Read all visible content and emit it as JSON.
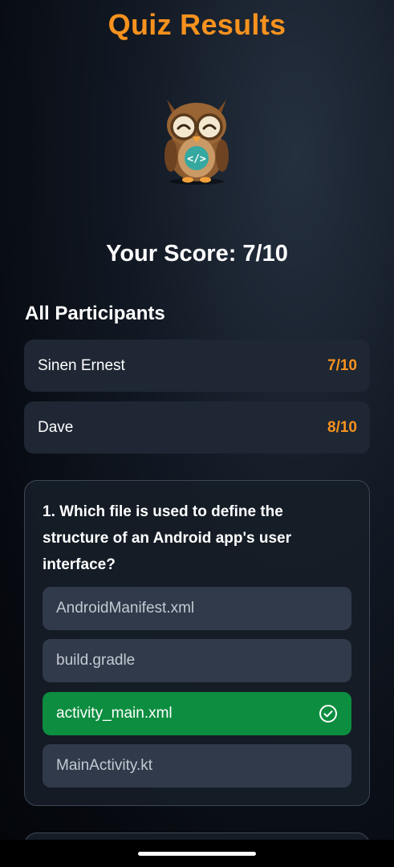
{
  "header": {
    "title": "Quiz Results"
  },
  "mascot": {
    "icon": "owl-mascot-icon",
    "badge_icon": "code-icon"
  },
  "score": {
    "text": "Your Score: 7/10"
  },
  "participants": {
    "title": "All Participants",
    "items": [
      {
        "name": "Sinen Ernest",
        "score": "7/10"
      },
      {
        "name": "Dave",
        "score": "8/10"
      }
    ]
  },
  "question": {
    "text": "1. Which file is used to define the structure of an Android app's user interface?",
    "options": [
      {
        "label": "AndroidManifest.xml",
        "correct": false
      },
      {
        "label": "build.gradle",
        "correct": false
      },
      {
        "label": "activity_main.xml",
        "correct": true
      },
      {
        "label": "MainActivity.kt",
        "correct": false
      }
    ]
  },
  "colors": {
    "accent": "#f7921e",
    "correct": "#0d8d3f",
    "card": "#1e2733",
    "option": "#303a4a"
  }
}
